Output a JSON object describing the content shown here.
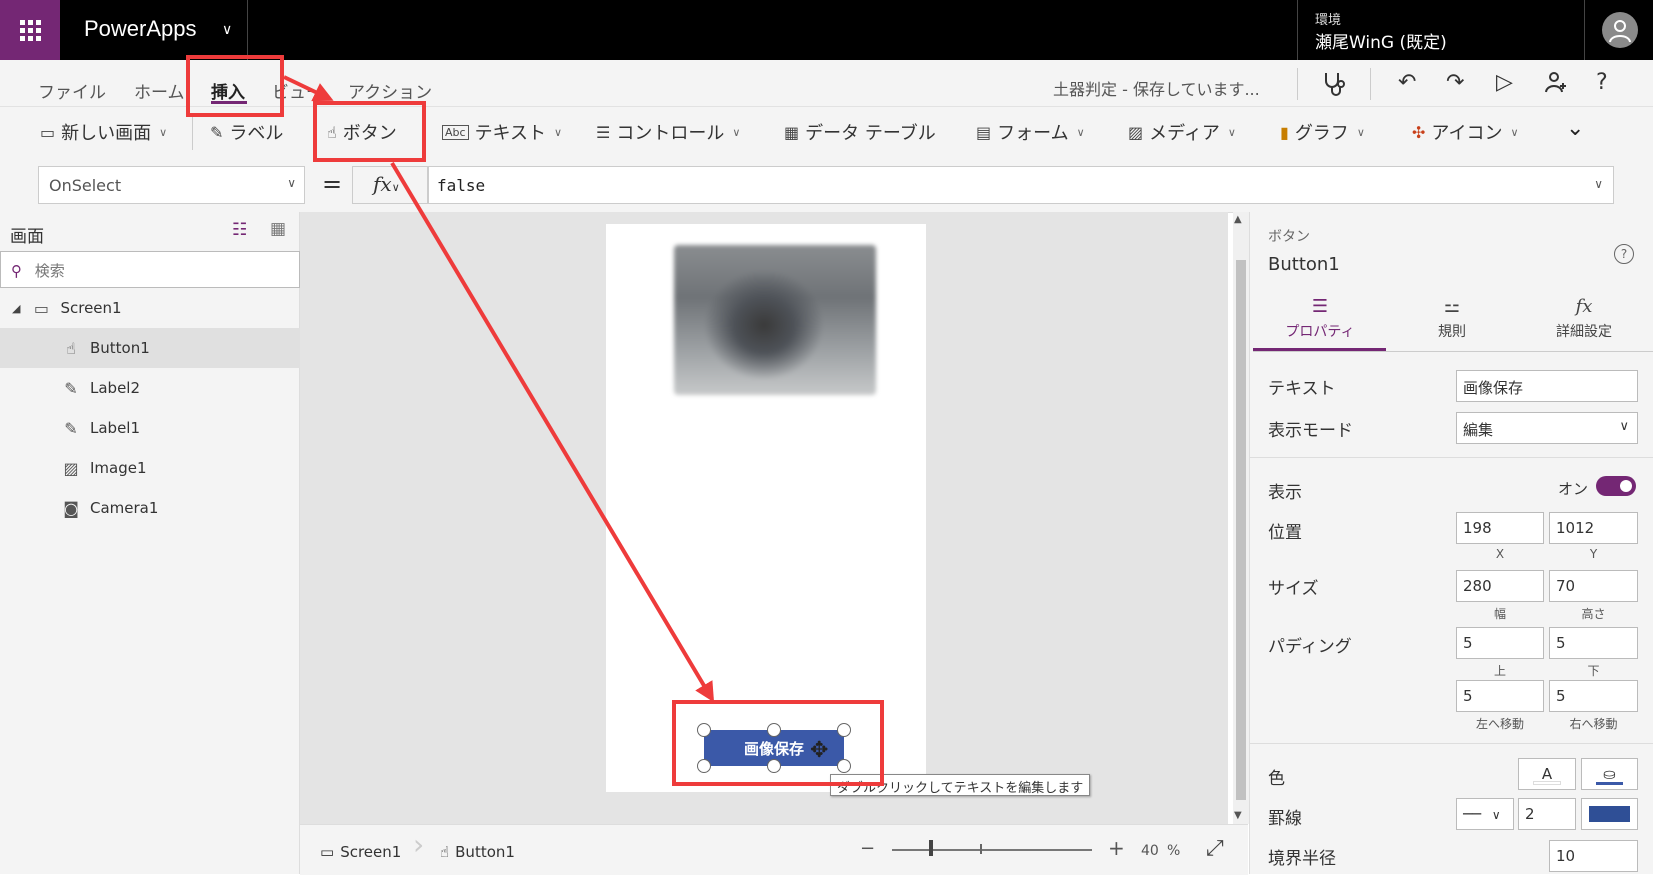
{
  "app": {
    "name": "PowerApps"
  },
  "environment": {
    "label": "環境",
    "name": "瀬尾WinG (既定)"
  },
  "menu": {
    "items": [
      "ファイル",
      "ホーム",
      "挿入",
      "ビュー",
      "アクション"
    ],
    "active": "挿入",
    "status": "土器判定 - 保存しています..."
  },
  "ribbon": {
    "new_screen": "新しい画面",
    "label": "ラベル",
    "button": "ボタン",
    "text": "テキスト",
    "controls": "コントロール",
    "data_table": "データ テーブル",
    "forms": "フォーム",
    "media": "メディア",
    "charts": "グラフ",
    "icons": "アイコン"
  },
  "formula": {
    "property": "OnSelect",
    "fx": "fx",
    "value": "false"
  },
  "tree": {
    "title": "画面",
    "search_placeholder": "検索",
    "items": [
      {
        "name": "Screen1"
      },
      {
        "name": "Button1"
      },
      {
        "name": "Label2"
      },
      {
        "name": "Label1"
      },
      {
        "name": "Image1"
      },
      {
        "name": "Camera1"
      }
    ]
  },
  "canvas": {
    "button_text": "画像保存",
    "tooltip": "ダブルクリックしてテキストを編集します"
  },
  "bottom": {
    "crumb_screen": "Screen1",
    "crumb_button": "Button1",
    "zoom": "40",
    "zoom_unit": "%"
  },
  "properties": {
    "type": "ボタン",
    "name": "Button1",
    "tabs": {
      "properties": "プロパティ",
      "rules": "規則",
      "advanced": "詳細設定"
    },
    "text_label": "テキスト",
    "text_value": "画像保存",
    "display_mode_label": "表示モード",
    "display_mode_value": "編集",
    "visible_label": "表示",
    "visible_value": "オン",
    "position_label": "位置",
    "x": "198",
    "y": "1012",
    "x_cap": "X",
    "y_cap": "Y",
    "size_label": "サイズ",
    "width": "280",
    "height": "70",
    "width_cap": "幅",
    "height_cap": "高さ",
    "padding_label": "パディング",
    "pad_top": "5",
    "pad_bottom": "5",
    "pad_left": "5",
    "pad_right": "5",
    "pad_top_cap": "上",
    "pad_bottom_cap": "下",
    "pad_left_cap": "左へ移動",
    "pad_right_cap": "右へ移動",
    "color_label": "色",
    "color_a": "A",
    "border_label": "罫線",
    "border_width": "2",
    "radius_label": "境界半径",
    "radius_value": "10"
  },
  "colors": {
    "accent": "#742774",
    "button_fill": "#3b59a8",
    "annotation": "#ee3b3b"
  }
}
